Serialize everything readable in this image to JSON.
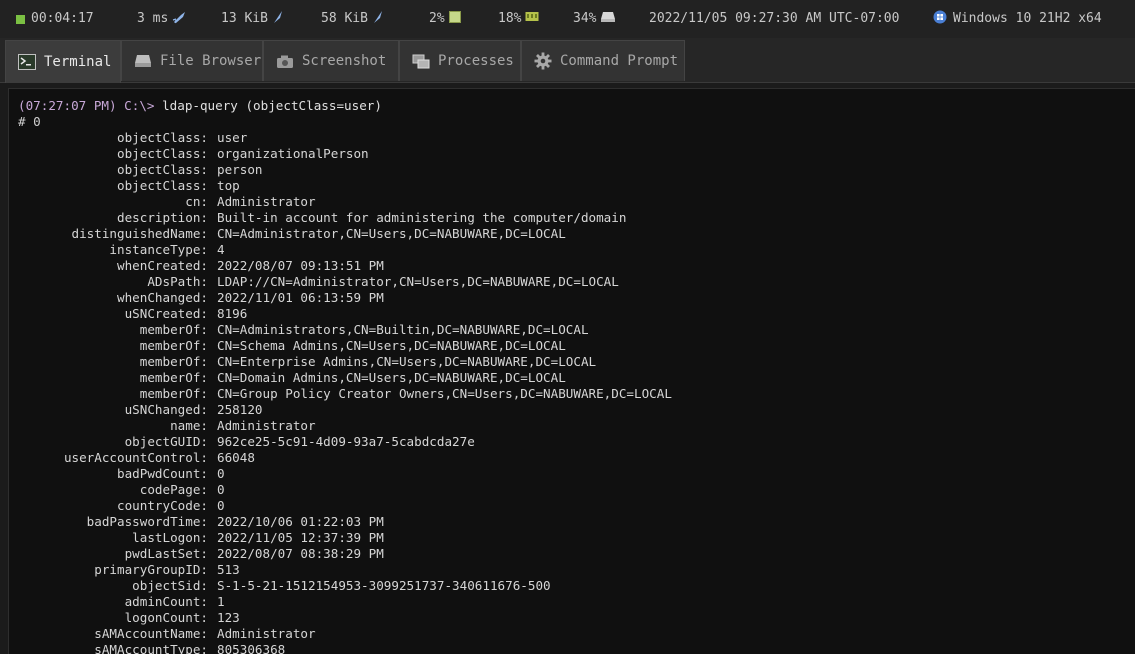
{
  "status": {
    "uptime": "00:04:17",
    "latency": "3 ms",
    "rx": "13 KiB",
    "tx": "58 KiB",
    "cpu": "2%",
    "mem": "18%",
    "disk": "34%",
    "datetime": "2022/11/05 09:27:30 AM UTC-07:00",
    "os": "Windows 10 21H2 x64",
    "colors": {
      "green": "#7bc043",
      "blue": "#4a7fd4"
    }
  },
  "tabs": [
    {
      "label": "Terminal",
      "icon": "terminal-icon",
      "active": true
    },
    {
      "label": "File Browser",
      "icon": "drive-icon",
      "active": false
    },
    {
      "label": "Screenshot",
      "icon": "camera-icon",
      "active": false
    },
    {
      "label": "Processes",
      "icon": "windows-stack-icon",
      "active": false
    },
    {
      "label": "Command Prompt",
      "icon": "gear-icon",
      "active": false
    }
  ],
  "terminal": {
    "prompt": "(07:27:07 PM) C:\\>",
    "command": " ldap-query (objectClass=user)",
    "result_header": "# 0",
    "entries": [
      {
        "k": "objectClass:",
        "v": "user"
      },
      {
        "k": "objectClass:",
        "v": "organizationalPerson"
      },
      {
        "k": "objectClass:",
        "v": "person"
      },
      {
        "k": "objectClass:",
        "v": "top"
      },
      {
        "k": "cn:",
        "v": "Administrator"
      },
      {
        "k": "description:",
        "v": "Built-in account for administering the computer/domain"
      },
      {
        "k": "distinguishedName:",
        "v": "CN=Administrator,CN=Users,DC=NABUWARE,DC=LOCAL"
      },
      {
        "k": "instanceType:",
        "v": "4"
      },
      {
        "k": "whenCreated:",
        "v": "2022/08/07 09:13:51 PM"
      },
      {
        "k": "ADsPath:",
        "v": "LDAP://CN=Administrator,CN=Users,DC=NABUWARE,DC=LOCAL"
      },
      {
        "k": "whenChanged:",
        "v": "2022/11/01 06:13:59 PM"
      },
      {
        "k": "uSNCreated:",
        "v": "8196"
      },
      {
        "k": "memberOf:",
        "v": "CN=Administrators,CN=Builtin,DC=NABUWARE,DC=LOCAL"
      },
      {
        "k": "memberOf:",
        "v": "CN=Schema Admins,CN=Users,DC=NABUWARE,DC=LOCAL"
      },
      {
        "k": "memberOf:",
        "v": "CN=Enterprise Admins,CN=Users,DC=NABUWARE,DC=LOCAL"
      },
      {
        "k": "memberOf:",
        "v": "CN=Domain Admins,CN=Users,DC=NABUWARE,DC=LOCAL"
      },
      {
        "k": "memberOf:",
        "v": "CN=Group Policy Creator Owners,CN=Users,DC=NABUWARE,DC=LOCAL"
      },
      {
        "k": "uSNChanged:",
        "v": "258120"
      },
      {
        "k": "name:",
        "v": "Administrator"
      },
      {
        "k": "objectGUID:",
        "v": "962ce25-5c91-4d09-93a7-5cabdcda27e"
      },
      {
        "k": "userAccountControl:",
        "v": "66048"
      },
      {
        "k": "badPwdCount:",
        "v": "0"
      },
      {
        "k": "codePage:",
        "v": "0"
      },
      {
        "k": "countryCode:",
        "v": "0"
      },
      {
        "k": "badPasswordTime:",
        "v": "2022/10/06 01:22:03 PM"
      },
      {
        "k": "lastLogon:",
        "v": "2022/11/05 12:37:39 PM"
      },
      {
        "k": "pwdLastSet:",
        "v": "2022/08/07 08:38:29 PM"
      },
      {
        "k": "primaryGroupID:",
        "v": "513"
      },
      {
        "k": "objectSid:",
        "v": "S-1-5-21-1512154953-3099251737-340611676-500"
      },
      {
        "k": "adminCount:",
        "v": "1"
      },
      {
        "k": "logonCount:",
        "v": "123"
      },
      {
        "k": "sAMAccountName:",
        "v": "Administrator"
      },
      {
        "k": "sAMAccountType:",
        "v": "805306368"
      }
    ]
  }
}
